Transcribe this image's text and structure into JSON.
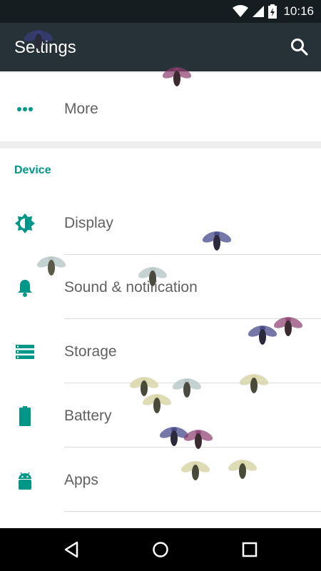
{
  "status_bar": {
    "time": "10:16",
    "icons": [
      "wifi-icon",
      "signal-icon",
      "battery-charging-icon"
    ]
  },
  "app_bar": {
    "title": "Settings",
    "search_icon": "search-icon"
  },
  "more_item": {
    "label": "More",
    "icon": "more-horiz-icon"
  },
  "device_section": {
    "header": "Device",
    "items": [
      {
        "label": "Display",
        "icon": "brightness-icon"
      },
      {
        "label": "Sound & notification",
        "icon": "bell-icon"
      },
      {
        "label": "Storage",
        "icon": "storage-icon"
      },
      {
        "label": "Battery",
        "icon": "battery-icon"
      },
      {
        "label": "Apps",
        "icon": "android-icon"
      }
    ]
  },
  "nav_bar": {
    "buttons": [
      "back-icon",
      "home-icon",
      "recents-icon"
    ]
  },
  "colors": {
    "accent": "#009688",
    "app_bar": "#263238",
    "status_bar": "#161d20",
    "text": "#616161"
  }
}
